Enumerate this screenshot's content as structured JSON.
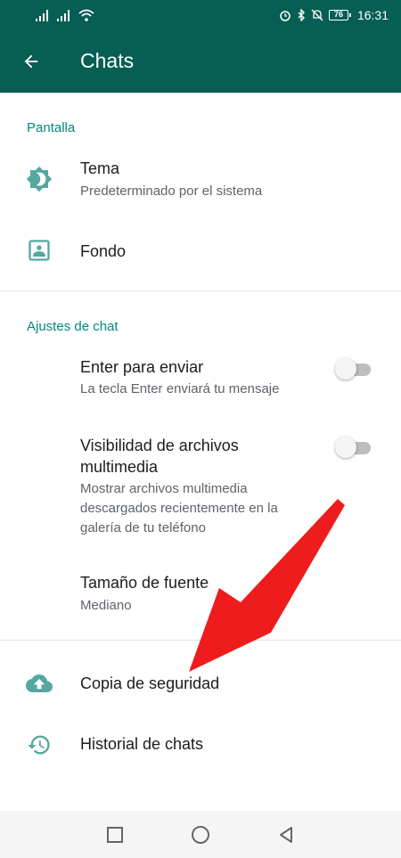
{
  "status_bar": {
    "battery": "76",
    "time": "16:31"
  },
  "app_bar": {
    "title": "Chats",
    "back_icon": "arrow-back-icon"
  },
  "sections": {
    "display": {
      "header": "Pantalla",
      "theme": {
        "title": "Tema",
        "subtitle": "Predeterminado por el sistema",
        "icon": "brightness-icon"
      },
      "wallpaper": {
        "title": "Fondo",
        "icon": "wallpaper-icon"
      }
    },
    "chat_settings": {
      "header": "Ajustes de chat",
      "enter_send": {
        "title": "Enter para enviar",
        "subtitle": "La tecla Enter enviará tu mensaje",
        "enabled": false
      },
      "media_visibility": {
        "title_line1": "Visibilidad de archivos",
        "title_line2": "multimedia",
        "subtitle_line1": "Mostrar archivos multimedia",
        "subtitle_line2": "descargados recientemente en la",
        "subtitle_line3": "galería de tu teléfono",
        "enabled": false
      },
      "font_size": {
        "title": "Tamaño de fuente",
        "subtitle": "Mediano"
      }
    },
    "other": {
      "backup": {
        "title": "Copia de seguridad",
        "icon": "cloud-upload-icon"
      },
      "history": {
        "title": "Historial de chats",
        "icon": "history-icon"
      }
    }
  },
  "colors": {
    "primary": "#075e54",
    "accent": "#00897b",
    "annotation_arrow": "#ee1c1c"
  },
  "nav_bar": {
    "recents_icon": "square-icon",
    "home_icon": "circle-icon",
    "back_icon": "triangle-back-icon"
  }
}
